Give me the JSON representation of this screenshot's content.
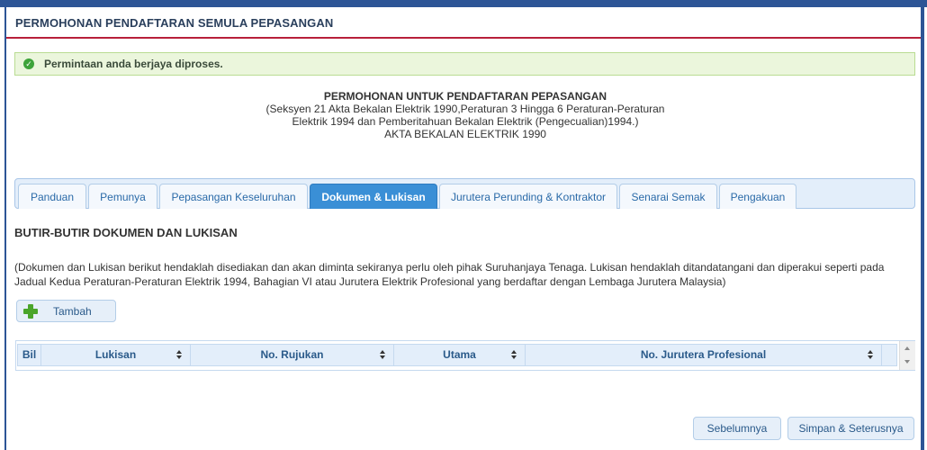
{
  "page": {
    "title": "PERMOHONAN PENDAFTARAN SEMULA PEPASANGAN"
  },
  "alert": {
    "icon": "check-circle-icon",
    "message": "Permintaan anda berjaya diproses."
  },
  "form_header": {
    "title": "PERMOHONAN UNTUK PENDAFTARAN PEPASANGAN",
    "lines": [
      "(Seksyen 21 Akta Bekalan Elektrik 1990,Peraturan 3 Hingga 6 Peraturan-Peraturan",
      "Elektrik 1994 dan Pemberitahuan Bekalan Elektrik (Pengecualian)1994.)",
      "AKTA BEKALAN ELEKTRIK 1990"
    ]
  },
  "tabs": [
    {
      "label": "Panduan",
      "active": false
    },
    {
      "label": "Pemunya",
      "active": false
    },
    {
      "label": "Pepasangan Keseluruhan",
      "active": false
    },
    {
      "label": "Dokumen & Lukisan",
      "active": true
    },
    {
      "label": "Jurutera Perunding & Kontraktor",
      "active": false
    },
    {
      "label": "Senarai Semak",
      "active": false
    },
    {
      "label": "Pengakuan",
      "active": false
    }
  ],
  "section": {
    "title": "BUTIR-BUTIR DOKUMEN DAN LUKISAN",
    "description": "(Dokumen dan Lukisan berikut hendaklah disediakan dan akan diminta sekiranya perlu oleh pihak Suruhanjaya Tenaga. Lukisan hendaklah ditandatangani dan diperakui seperti pada Jadual Kedua Peraturan-Peraturan Elektrik 1994, Bahagian VI atau Jurutera Elektrik Profesional yang berdaftar dengan Lembaga Jurutera Malaysia)"
  },
  "add_button": {
    "label": "Tambah",
    "icon": "plus-icon"
  },
  "table": {
    "columns": [
      "Bil",
      "Lukisan",
      "No. Rujukan",
      "Utama",
      "No. Jurutera Profesional"
    ],
    "rows": []
  },
  "footer": {
    "prev_label": "Sebelumnya",
    "save_next_label": "Simpan & Seterusnya"
  },
  "colors": {
    "frame": "#2d5596",
    "title_rule": "#b8203a",
    "active_tab": "#3a8fd6",
    "success_bg": "#ebf6dc"
  }
}
